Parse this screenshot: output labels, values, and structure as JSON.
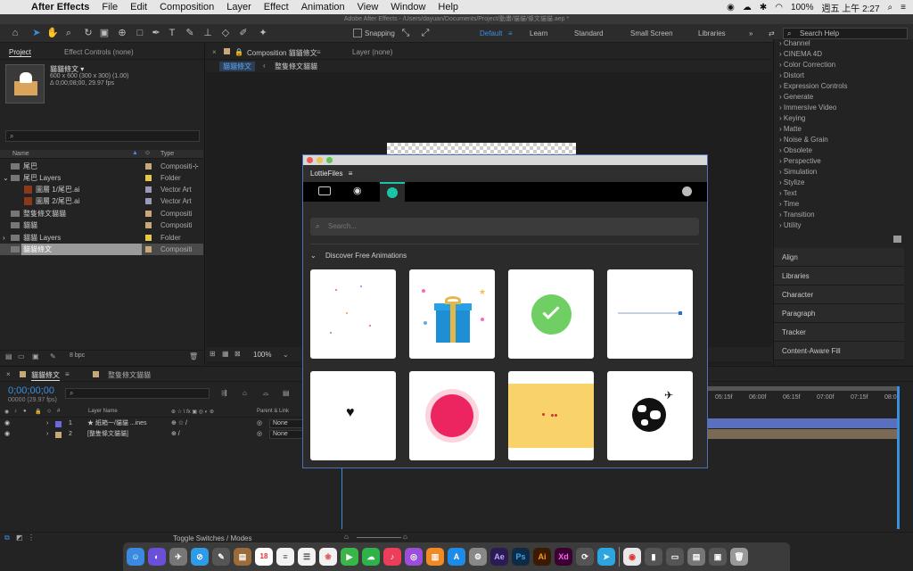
{
  "menubar": {
    "app": "After Effects",
    "items": [
      "File",
      "Edit",
      "Composition",
      "Layer",
      "Effect",
      "Animation",
      "View",
      "Window",
      "Help"
    ],
    "battery": "100%",
    "clock": "週五 上午 2:27"
  },
  "window_title": "Adobe After Effects - /Users/dayuan/Documents/Project/動畫/貓貓/條文貓貓.aep *",
  "toolbar": {
    "snapping": "Snapping",
    "workspaces": [
      "Default",
      "Learn",
      "Standard",
      "Small Screen",
      "Libraries"
    ],
    "active_workspace": "Default",
    "search_help": "Search Help"
  },
  "project": {
    "tab": "Project",
    "effect_controls": "Effect Controls (none)",
    "item_name": "貓貓條文 ▾",
    "item_info1": "600 x 600  (300 x 300) (1.00)",
    "item_info2": "Δ 0;00;08;00, 29.97 fps",
    "col_name": "Name",
    "col_type": "Type",
    "bpc": "8 bpc",
    "rows": [
      {
        "name": "尾巴",
        "type": "Compositi",
        "color": "#c8a878"
      },
      {
        "name": "尾巴 Layers",
        "type": "Folder",
        "color": "#e6c84a"
      },
      {
        "name": "圖層 1/尾巴.ai",
        "type": "Vector Art",
        "color": "#9a9ab8"
      },
      {
        "name": "圖層 2/尾巴.ai",
        "type": "Vector Art",
        "color": "#9a9ab8"
      },
      {
        "name": "整隻條文貓貓",
        "type": "Compositi",
        "color": "#c8a878"
      },
      {
        "name": "貓貓",
        "type": "Compositi",
        "color": "#c8a878"
      },
      {
        "name": "貓貓 Layers",
        "type": "Folder",
        "color": "#e6c84a"
      },
      {
        "name": "貓貓條文",
        "type": "Compositi",
        "color": "#c8a878"
      }
    ]
  },
  "composition": {
    "tab": "Composition 貓貓條文",
    "layer_tab": "Layer (none)",
    "breadcrumb1": "貓貓條文",
    "breadcrumb2": "整隻條文貓貓",
    "zoom": "100%"
  },
  "effects_list": [
    "Channel",
    "CINEMA 4D",
    "Color Correction",
    "Distort",
    "Expression Controls",
    "Generate",
    "Immersive Video",
    "Keying",
    "Matte",
    "Noise & Grain",
    "Obsolete",
    "Perspective",
    "Simulation",
    "Stylize",
    "Text",
    "Time",
    "Transition",
    "Utility"
  ],
  "right_panels": [
    "Align",
    "Libraries",
    "Character",
    "Paragraph",
    "Tracker",
    "Content-Aware Fill"
  ],
  "lottie": {
    "title": "LottieFiles",
    "search_placeholder": "Search...",
    "section": "Discover Free Animations"
  },
  "timeline": {
    "tab1": "貓貓條文",
    "tab2": "整隻條文貓貓",
    "timecode": "0;00;00;00",
    "frame_info": "00000 (29.97 fps)",
    "col_layer_name": "Layer Name",
    "col_parent": "Parent & Link",
    "layers": [
      {
        "num": "1",
        "name": "★ 紙箱一/貓貓 ...ines",
        "parent": "None",
        "color": "#6a6ae0"
      },
      {
        "num": "2",
        "name": "[整隻條文貓貓]",
        "parent": "None",
        "color": "#c8a878"
      }
    ],
    "ruler": [
      "05:15f",
      "06:00f",
      "06:15f",
      "07:00f",
      "07:15f",
      "08:0"
    ],
    "toggle": "Toggle Switches / Modes"
  },
  "dock": {
    "calendar_day": "18",
    "apps": [
      "Ae",
      "Ps",
      "Ai",
      "Xd"
    ]
  }
}
